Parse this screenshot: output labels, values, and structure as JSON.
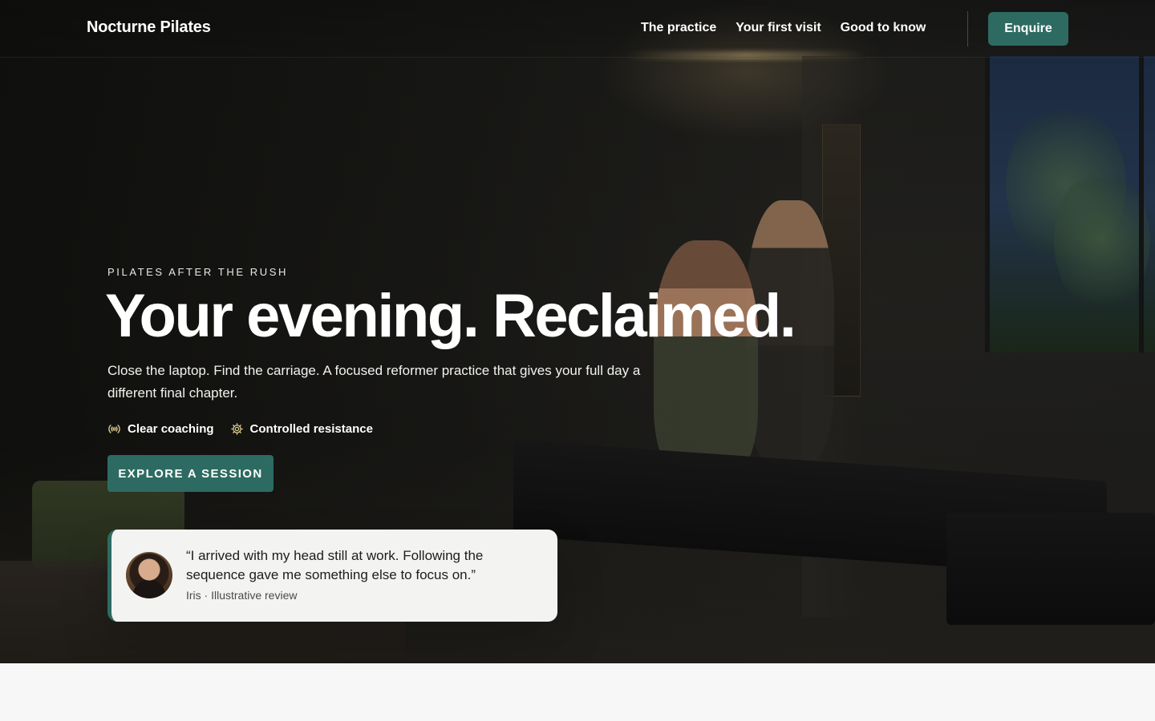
{
  "header": {
    "brand": "Nocturne Pilates",
    "nav": [
      {
        "label": "The practice"
      },
      {
        "label": "Your first visit"
      },
      {
        "label": "Good to know"
      }
    ],
    "cta_label": "Enquire"
  },
  "hero": {
    "eyebrow": "PILATES AFTER THE RUSH",
    "headline": "Your evening. Reclaimed.",
    "subtext": "Close the laptop. Find the carriage. A focused reformer practice that gives your full day a different final chapter.",
    "features": [
      {
        "icon": "broadcast-icon",
        "label": "Clear coaching"
      },
      {
        "icon": "gear-icon",
        "label": "Controlled resistance"
      }
    ],
    "cta_label": "EXPLORE A SESSION"
  },
  "review": {
    "quote": "“I arrived with my head still at work. Following the sequence gave me something else to focus on.”",
    "attribution": "Iris · Illustrative review"
  },
  "colors": {
    "accent": "#2d6b62",
    "page_background": "#f6f7f6",
    "card_background": "#f3f3f1"
  }
}
